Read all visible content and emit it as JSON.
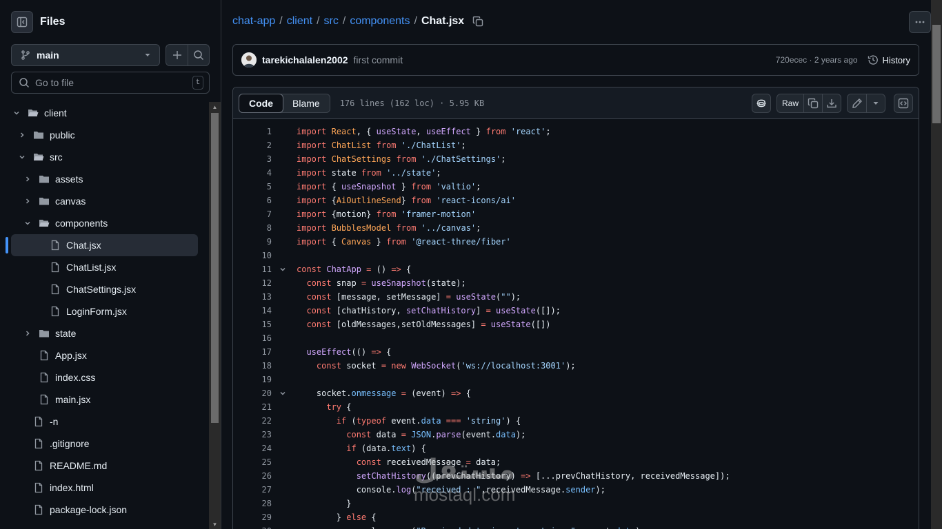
{
  "sidebar": {
    "title": "Files",
    "branch": "main",
    "goto_placeholder": "Go to file",
    "goto_shortcut": "t",
    "tree": [
      {
        "label": "client",
        "icon": "folder-open-icon",
        "expanded": true
      },
      {
        "label": "public",
        "icon": "folder-icon"
      },
      {
        "label": "src",
        "icon": "folder-open-icon",
        "expanded": true
      },
      {
        "label": "assets",
        "icon": "folder-icon"
      },
      {
        "label": "canvas",
        "icon": "folder-icon"
      },
      {
        "label": "components",
        "icon": "folder-open-icon",
        "expanded": true
      },
      {
        "label": "Chat.jsx",
        "icon": "file-icon",
        "active": true
      },
      {
        "label": "ChatList.jsx",
        "icon": "file-icon"
      },
      {
        "label": "ChatSettings.jsx",
        "icon": "file-icon"
      },
      {
        "label": "LoginForm.jsx",
        "icon": "file-icon"
      },
      {
        "label": "state",
        "icon": "folder-icon"
      },
      {
        "label": "App.jsx",
        "icon": "file-icon"
      },
      {
        "label": "index.css",
        "icon": "file-icon"
      },
      {
        "label": "main.jsx",
        "icon": "file-icon"
      },
      {
        "label": "-n",
        "icon": "file-icon"
      },
      {
        "label": ".gitignore",
        "icon": "file-icon"
      },
      {
        "label": "README.md",
        "icon": "file-icon"
      },
      {
        "label": "index.html",
        "icon": "file-icon"
      },
      {
        "label": "package-lock.json",
        "icon": "file-icon"
      }
    ]
  },
  "breadcrumb": {
    "parts": [
      "chat-app",
      "client",
      "src",
      "components"
    ],
    "current": "Chat.jsx"
  },
  "commit": {
    "author": "tarekichalalen2002",
    "message": "first commit",
    "meta": "720ecec · 2 years ago",
    "history_label": "History"
  },
  "toolbar": {
    "code_tab": "Code",
    "blame_tab": "Blame",
    "file_info": "176 lines (162 loc) · 5.95 KB",
    "raw_label": "Raw"
  },
  "code_lines": [
    "import React, { useState, useEffect } from 'react';",
    "import ChatList from './ChatList';",
    "import ChatSettings from './ChatSettings';",
    "import state from '../state';",
    "import { useSnapshot } from 'valtio';",
    "import {AiOutlineSend} from 'react-icons/ai'",
    "import {motion} from 'framer-motion'",
    "import BubblesModel from '../canvas';",
    "import { Canvas } from '@react-three/fiber'",
    "",
    "const ChatApp = () => {",
    "  const snap = useSnapshot(state);",
    "  const [message, setMessage] = useState(\"\");",
    "  const [chatHistory, setChatHistory] = useState([]);",
    "  const [oldMessages,setOldMessages] = useState([])",
    "",
    "  useEffect(() => {",
    "    const socket = new WebSocket('ws://localhost:3001');",
    "",
    "    socket.onmessage = (event) => {",
    "      try {",
    "        if (typeof event.data === 'string') {",
    "          const data = JSON.parse(event.data);",
    "          if (data.text) {",
    "            const receivedMessage = data;",
    "            setChatHistory((prevChatHistory) => [...prevChatHistory, receivedMessage]);",
    "            console.log(\"received : \",receivedMessage.sender);",
    "          }",
    "        } else {",
    "          console.error(\"Received data is not a string:\", event.data);"
  ],
  "fold_lines": [
    11,
    20
  ],
  "watermark": {
    "arabic": "مستقل",
    "latin": "mostaql.com"
  }
}
